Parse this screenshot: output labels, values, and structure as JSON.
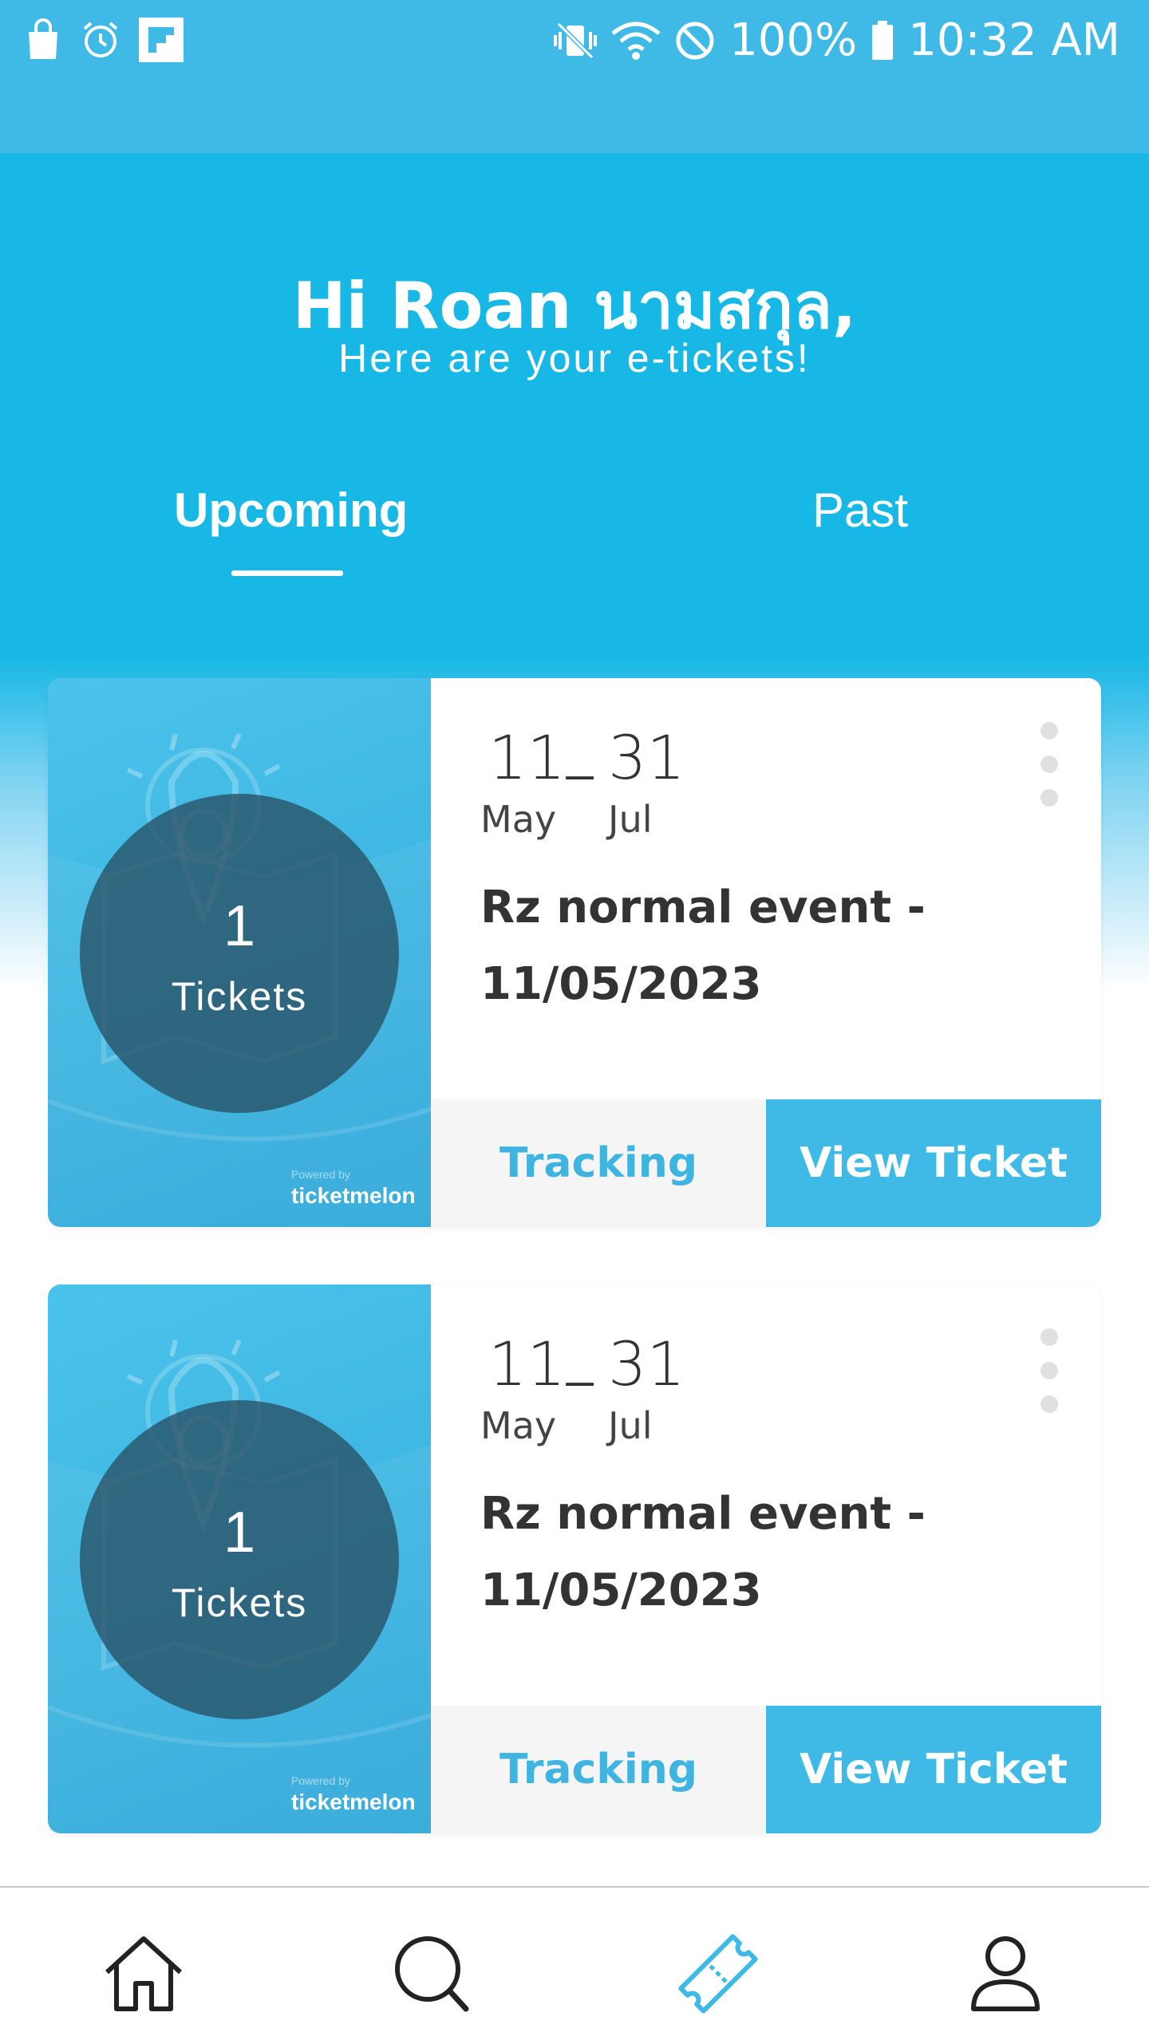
{
  "status_bar": {
    "battery": "100%",
    "time": "10:32 AM",
    "icons": [
      "shopping-bag-icon",
      "alarm-icon",
      "flipboard-icon",
      "vibrate-icon",
      "wifi-icon",
      "dnd-icon",
      "battery-icon"
    ]
  },
  "header": {
    "greeting": "Hi Roan นามสกุล,",
    "subtitle": "Here are your e-tickets!"
  },
  "tabs": [
    {
      "label": "Upcoming",
      "active": true
    },
    {
      "label": "Past",
      "active": false
    }
  ],
  "tickets": [
    {
      "count": "1",
      "count_label": "Tickets",
      "powered_by": "Powered by",
      "brand": "ticketmelon",
      "start_day": "11",
      "start_month": "May",
      "separator": "_",
      "end_day": "31",
      "end_month": "Jul",
      "title": "Rz normal event - 11/05/2023",
      "tracking_label": "Tracking",
      "view_label": "View Ticket"
    },
    {
      "count": "1",
      "count_label": "Tickets",
      "powered_by": "Powered by",
      "brand": "ticketmelon",
      "start_day": "11",
      "start_month": "May",
      "separator": "_",
      "end_day": "31",
      "end_month": "Jul",
      "title": "Rz normal event - 11/05/2023",
      "tracking_label": "Tracking",
      "view_label": "View Ticket"
    }
  ],
  "bottom_nav": [
    {
      "icon": "home-icon",
      "active": false
    },
    {
      "icon": "search-icon",
      "active": false
    },
    {
      "icon": "ticket-icon",
      "active": true
    },
    {
      "icon": "profile-icon",
      "active": false
    }
  ],
  "colors": {
    "primary": "#17b7e6",
    "button": "#3fb9e6",
    "text": "#333333"
  }
}
